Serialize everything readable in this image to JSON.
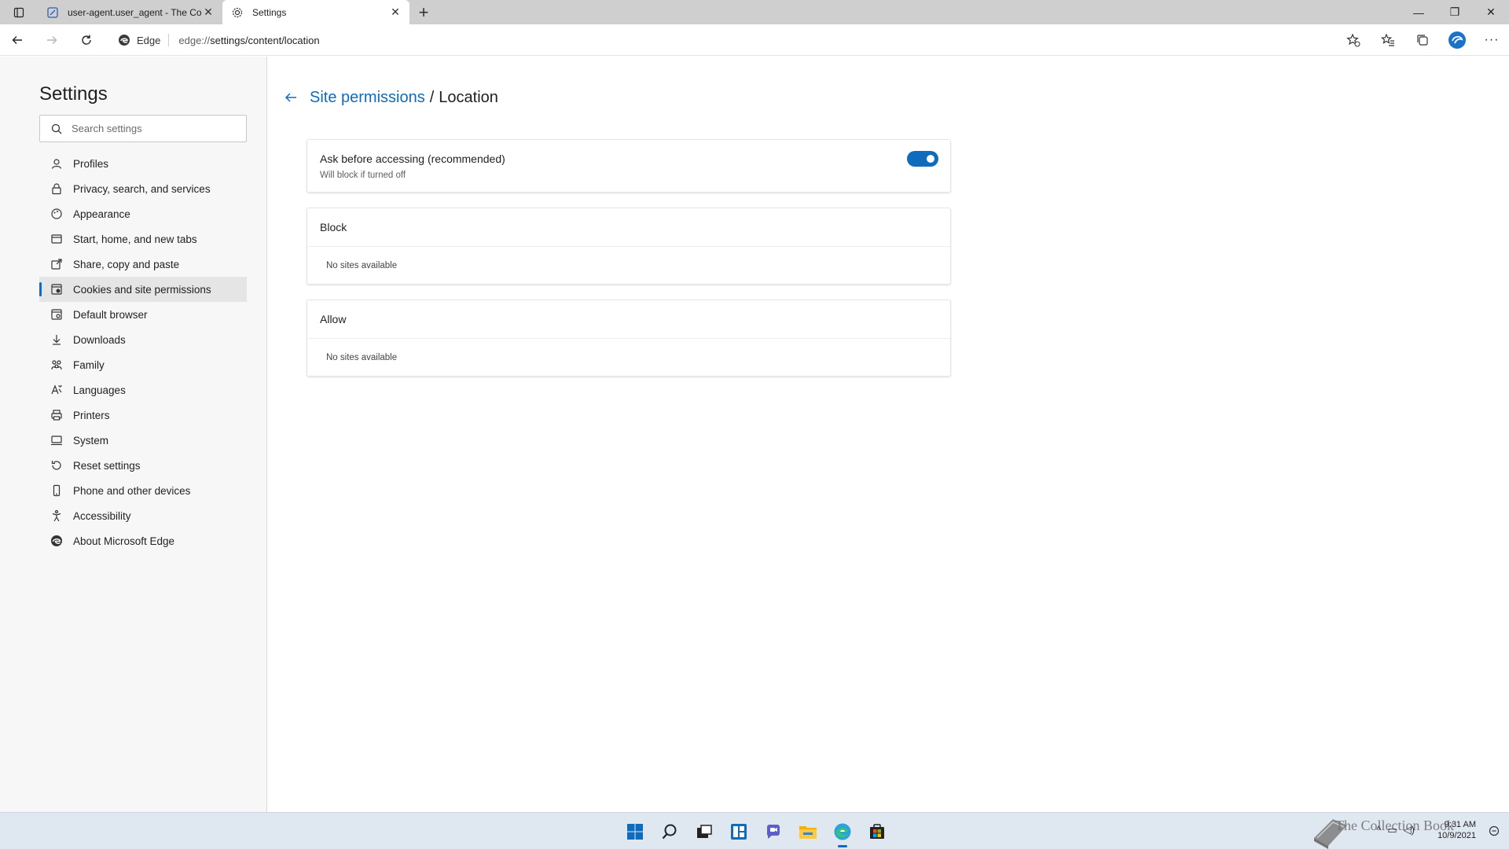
{
  "tabs": [
    {
      "title": "user-agent.user_agent - The Coll",
      "active": false,
      "favicon": "document-edit-icon"
    },
    {
      "title": "Settings",
      "active": true,
      "favicon": "gear-icon"
    }
  ],
  "address": {
    "identity_label": "Edge",
    "url_protocol": "edge://",
    "url_rest": "settings/content/location"
  },
  "sidebar": {
    "title": "Settings",
    "search_placeholder": "Search settings",
    "items": [
      {
        "label": "Profiles",
        "icon": "profile-icon",
        "active": false
      },
      {
        "label": "Privacy, search, and services",
        "icon": "lock-icon",
        "active": false
      },
      {
        "label": "Appearance",
        "icon": "appearance-icon",
        "active": false
      },
      {
        "label": "Start, home, and new tabs",
        "icon": "home-tabs-icon",
        "active": false
      },
      {
        "label": "Share, copy and paste",
        "icon": "share-icon",
        "active": false
      },
      {
        "label": "Cookies and site permissions",
        "icon": "cookies-icon",
        "active": true
      },
      {
        "label": "Default browser",
        "icon": "browser-icon",
        "active": false
      },
      {
        "label": "Downloads",
        "icon": "download-icon",
        "active": false
      },
      {
        "label": "Family",
        "icon": "family-icon",
        "active": false
      },
      {
        "label": "Languages",
        "icon": "languages-icon",
        "active": false
      },
      {
        "label": "Printers",
        "icon": "printer-icon",
        "active": false
      },
      {
        "label": "System",
        "icon": "system-icon",
        "active": false
      },
      {
        "label": "Reset settings",
        "icon": "reset-icon",
        "active": false
      },
      {
        "label": "Phone and other devices",
        "icon": "phone-icon",
        "active": false
      },
      {
        "label": "Accessibility",
        "icon": "accessibility-icon",
        "active": false
      },
      {
        "label": "About Microsoft Edge",
        "icon": "edge-logo-icon",
        "active": false
      }
    ]
  },
  "main": {
    "breadcrumb_parent": "Site permissions",
    "breadcrumb_separator": "/",
    "breadcrumb_current": "Location",
    "ask_toggle": {
      "title": "Ask before accessing (recommended)",
      "subtitle": "Will block if turned off",
      "enabled": true
    },
    "block": {
      "header": "Block",
      "empty_text": "No sites available"
    },
    "allow": {
      "header": "Allow",
      "empty_text": "No sites available"
    }
  },
  "taskbar": {
    "apps": [
      "start-icon",
      "search-icon",
      "task-view-icon",
      "widgets-icon",
      "chat-icon",
      "file-explorer-icon",
      "edge-icon",
      "store-icon"
    ],
    "time": "9:31 AM",
    "date": "10/9/2021",
    "watermark": "The Collection Book"
  },
  "colors": {
    "accent": "#0f6cbd",
    "sidebar_bg": "#f7f7f7",
    "tabstrip_bg": "#cfcfcf",
    "taskbar_bg": "#dfe7f0"
  }
}
